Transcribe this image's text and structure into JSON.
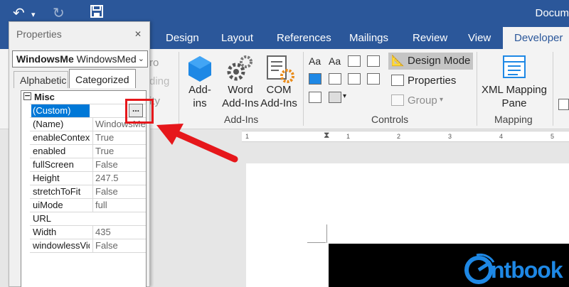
{
  "window": {
    "title": "Docum"
  },
  "qat": {
    "undo_icon": "undo-icon",
    "redo_icon": "redo-icon",
    "save_icon": "save-icon"
  },
  "tabs": [
    {
      "label": "Design"
    },
    {
      "label": "Layout"
    },
    {
      "label": "References"
    },
    {
      "label": "Mailings"
    },
    {
      "label": "Review"
    },
    {
      "label": "View"
    },
    {
      "label": "Developer"
    }
  ],
  "ribbon": {
    "partial": {
      "label1": "ro",
      "label2": "ding",
      "label3": "ity"
    },
    "addins": {
      "addins_line1": "Add-",
      "addins_line2": "ins",
      "word_line1": "Word",
      "word_line2": "Add-Ins",
      "com_line1": "COM",
      "com_line2": "Add-Ins",
      "group": "Add-Ins"
    },
    "controls": {
      "design_mode": "Design Mode",
      "properties": "Properties",
      "group_btn": "Group",
      "group": "Controls"
    },
    "mapping": {
      "xml_line1": "XML Mapping",
      "xml_line2": "Pane",
      "group": "Mapping"
    }
  },
  "ruler": {
    "ticks": [
      "1",
      "1",
      "2",
      "3",
      "4",
      "5"
    ]
  },
  "properties_pane": {
    "title": "Properties",
    "object_name": "WindowsMe",
    "object_type": "WindowsMed",
    "tabs": {
      "alphabetic": "Alphabetic",
      "categorized": "Categorized"
    },
    "category": "Misc",
    "rows": [
      {
        "name": "(Custom)",
        "value": ""
      },
      {
        "name": "(Name)",
        "value": "WindowsMed"
      },
      {
        "name": "enableContex",
        "value": "True"
      },
      {
        "name": "enabled",
        "value": "True"
      },
      {
        "name": "fullScreen",
        "value": "False"
      },
      {
        "name": "Height",
        "value": "247.5"
      },
      {
        "name": "stretchToFit",
        "value": "False"
      },
      {
        "name": "uiMode",
        "value": "full"
      },
      {
        "name": "URL",
        "value": ""
      },
      {
        "name": "Width",
        "value": "435"
      },
      {
        "name": "windowlessVid",
        "value": "False"
      }
    ],
    "ellipsis_label": "..."
  },
  "watermark": {
    "text": "ntbook"
  },
  "colors": {
    "accent": "#2b579a",
    "highlight": "#e6171b",
    "selection": "#0078d7"
  }
}
